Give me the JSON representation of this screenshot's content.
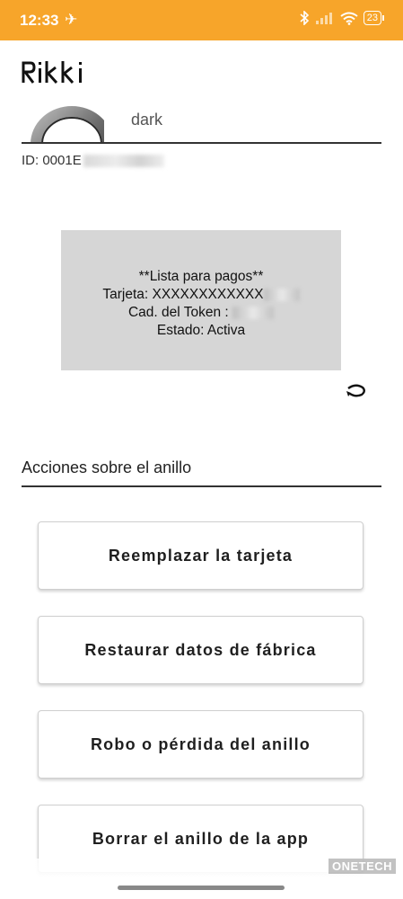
{
  "status_bar": {
    "time": "12:33",
    "battery": "23",
    "icons": [
      "airplane-icon",
      "bluetooth-icon",
      "signal-icon",
      "wifi-icon",
      "battery-icon"
    ],
    "color": "#f7a52a"
  },
  "brand": {
    "logo_text": "Rikki"
  },
  "ring": {
    "name": "dark",
    "id_prefix": "ID: 0001E"
  },
  "card": {
    "line1": "**Lista para pagos**",
    "line2": "Tarjeta: XXXXXXXXXXXX",
    "line3": "Cad. del Token :",
    "line4": "Estado: Activa",
    "background": "#d6d6d6"
  },
  "section": {
    "title": "Acciones sobre el anillo"
  },
  "actions": [
    {
      "label": "Reemplazar la tarjeta"
    },
    {
      "label": "Restaurar datos de fábrica"
    },
    {
      "label": "Robo o pérdida del anillo"
    },
    {
      "label": "Borrar el anillo de la app"
    }
  ],
  "watermark": "ONETECH"
}
